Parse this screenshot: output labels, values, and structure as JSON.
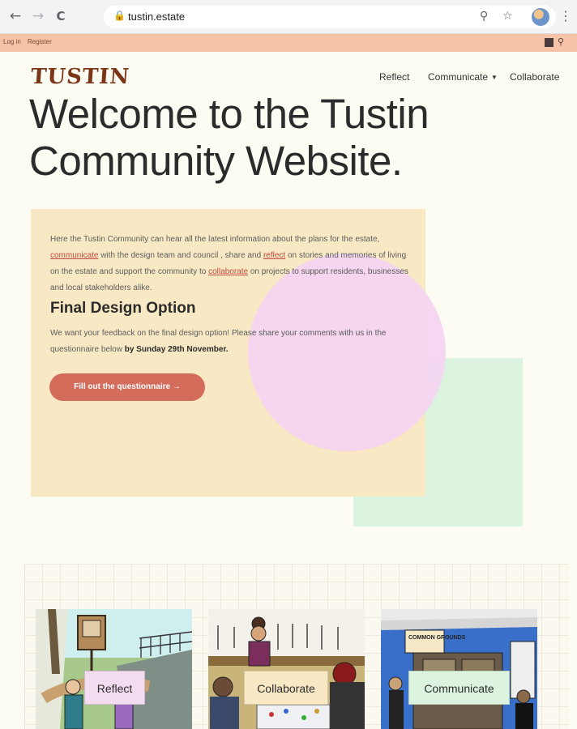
{
  "browser": {
    "url": "tustin.estate",
    "back_glyph": "←",
    "forward_glyph": "→",
    "reload_glyph": "C",
    "lock_glyph": "🔒",
    "zoom_glyph": "⚲",
    "star_glyph": "☆",
    "menu_glyph": "⋮"
  },
  "utility_bar": {
    "login": "Log in",
    "register": "Register",
    "search_glyph": "⚲"
  },
  "header": {
    "logo": "TUSTIN",
    "nav": [
      {
        "label": "Reflect"
      },
      {
        "label": "Communicate",
        "caret": "▼"
      },
      {
        "label": "Collaborate"
      }
    ]
  },
  "hero": {
    "title": "Welcome to the Tustin Community Website."
  },
  "intro": {
    "p1": "Here the Tustin Community can hear all the latest information about the plans for the estate, ",
    "link_communicate": "communicate",
    "p2": " with the design team and council , share and ",
    "link_reflect": "reflect",
    "p3": " on stories and memories of living on the estate and support the community to ",
    "link_collaborate": "collaborate",
    "p4": " on projects to support residents, businesses and local stakeholders alike.",
    "heading": "Final Design Option",
    "design_text": "We want your feedback on the final design option! Please share your comments with us in the questionnaire below ",
    "deadline": "by Sunday 29th November.",
    "cta": "Fill out the questionnaire →"
  },
  "cards": [
    {
      "label": "Reflect",
      "label_bg": "#f3dcef"
    },
    {
      "label": "Collaborate",
      "label_bg": "#f8e9c4"
    },
    {
      "label": "Communicate",
      "label_bg": "#dbf3df"
    }
  ],
  "communicate_sign": "COMMON GROUNDS",
  "colors": {
    "accent_salmon": "#f7c3a6",
    "logo_brown": "#7b3517",
    "cta": "#d36c5b",
    "card_yellow": "#f8e9c4",
    "pink": "#f4d4f1",
    "green": "#dbf3df"
  }
}
